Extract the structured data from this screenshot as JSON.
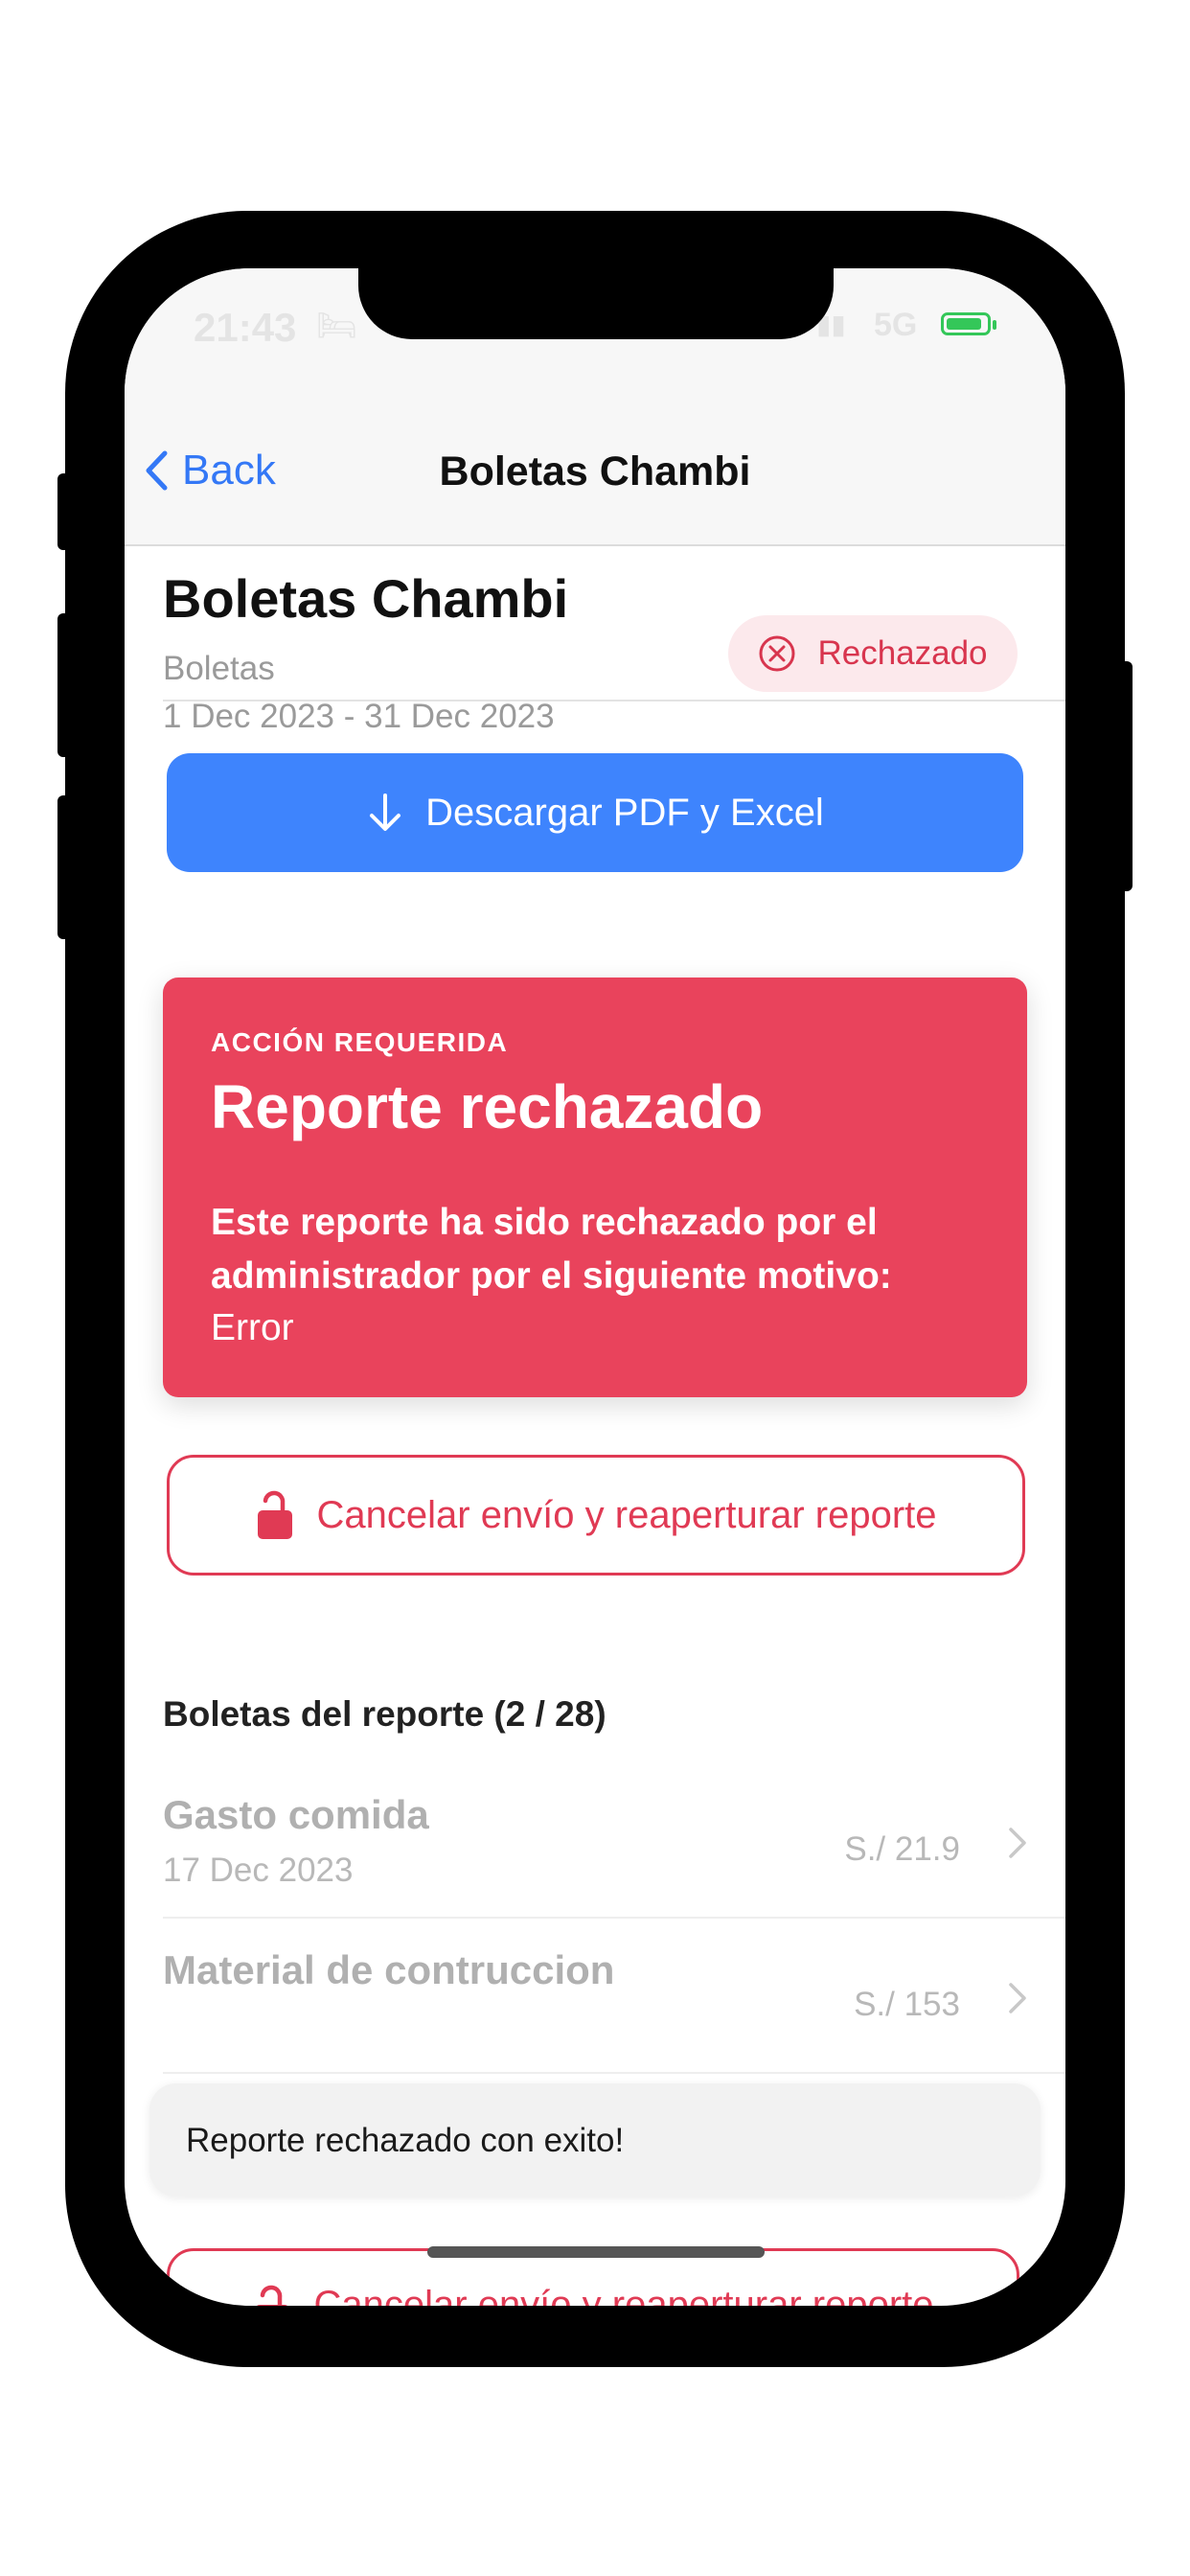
{
  "status_bar": {
    "time": "21:43",
    "network": "5G",
    "battery_level": 0.9
  },
  "nav": {
    "back_label": "Back",
    "title": "Boletas Chambi"
  },
  "report": {
    "title": "Boletas Chambi",
    "type": "Boletas",
    "date_range": "1 Dec 2023 - 31 Dec 2023",
    "status": "Rechazado"
  },
  "download_button": {
    "label": "Descargar PDF y Excel"
  },
  "alert": {
    "kicker": "ACCIÓN REQUERIDA",
    "title": "Reporte rechazado",
    "message": "Este reporte ha sido rechazado por el administrador por el siguiente motivo:",
    "reason": "Error"
  },
  "reopen_button": {
    "label": "Cancelar envío y reaperturar reporte"
  },
  "receipts": {
    "section_title": "Boletas del reporte (2 / 28)",
    "items": [
      {
        "name": "Gasto comida",
        "date": "17 Dec 2023",
        "amount": "S./ 21.9"
      },
      {
        "name": "Material de contruccion",
        "date": "",
        "amount": "S./ 153"
      }
    ]
  },
  "toast": {
    "message": "Reporte rechazado con exito!"
  },
  "colors": {
    "accent": "#3e84fd",
    "danger": "#e9435c",
    "badge_bg": "#fce9ec"
  }
}
